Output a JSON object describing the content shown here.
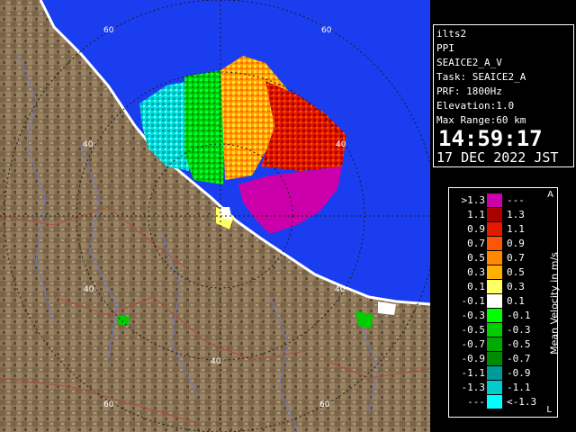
{
  "info": {
    "site": "ilts2",
    "mode": "PPI",
    "product": "SEAICE2_A_V",
    "task": "Task: SEAICE2_A",
    "prf": "PRF: 1800Hz",
    "elevation": "Elevation:1.0",
    "max_range": "Max Range:60 km",
    "time": "14:59:17",
    "date": "17 DEC 2022 JST"
  },
  "range_rings": {
    "labels": [
      "60",
      "40",
      "40",
      "40",
      "40",
      "60"
    ]
  },
  "legend": {
    "title": "Mean Velocity in m/s",
    "top_mark": "A",
    "bottom_mark": "L",
    "rows": [
      {
        "left": ">1.3",
        "right": "---",
        "color": "#cc00aa"
      },
      {
        "left": "1.1",
        "right": "1.3",
        "color": "#aa0000"
      },
      {
        "left": "0.9",
        "right": "1.1",
        "color": "#e41a00"
      },
      {
        "left": "0.7",
        "right": "0.9",
        "color": "#ff5500"
      },
      {
        "left": "0.5",
        "right": "0.7",
        "color": "#ff8800"
      },
      {
        "left": "0.3",
        "right": "0.5",
        "color": "#ffb000"
      },
      {
        "left": "0.1",
        "right": "0.3",
        "color": "#ffff66"
      },
      {
        "left": "-0.1",
        "right": "0.1",
        "color": "#ffffff"
      },
      {
        "left": "-0.3",
        "right": "-0.1",
        "color": "#00ff00"
      },
      {
        "left": "-0.5",
        "right": "-0.3",
        "color": "#00cc00"
      },
      {
        "left": "-0.7",
        "right": "-0.5",
        "color": "#00aa00"
      },
      {
        "left": "-0.9",
        "right": "-0.7",
        "color": "#008a00"
      },
      {
        "left": "-1.1",
        "right": "-0.9",
        "color": "#009999"
      },
      {
        "left": "-1.3",
        "right": "-1.1",
        "color": "#00cccc"
      },
      {
        "left": "---",
        "right": "<-1.3",
        "color": "#00ffff"
      }
    ]
  },
  "colors": {
    "sea": "#1a3df0",
    "land": "#8a7458",
    "land_dark": "#5e4a34",
    "river": "#6a78c8",
    "coast": "#ffffff"
  }
}
